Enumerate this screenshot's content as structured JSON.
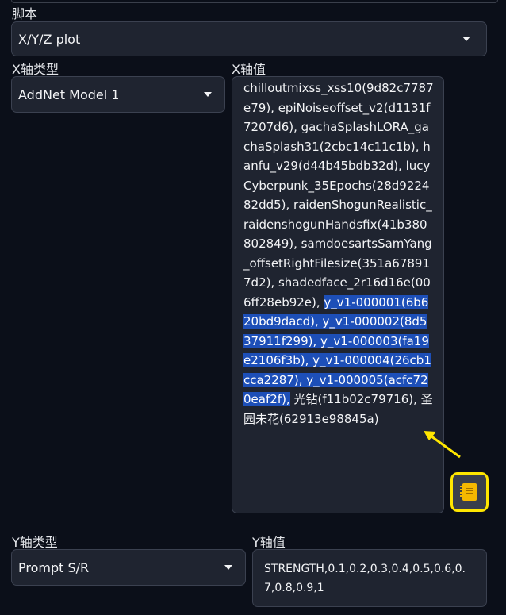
{
  "script": {
    "label": "脚本",
    "value": "X/Y/Z plot"
  },
  "x_axis": {
    "type_label": "X轴类型",
    "type_value": "AddNet Model 1",
    "values_label": "X轴值",
    "values_text_before": "chilloutmixss_xss10(9d82c7787e79), epiNoiseoffset_v2(d1131f7207d6), gachaSplashLORA_gachaSplash31(2cbc14c11c1b), hanfu_v29(d44b45bdb32d), lucyCyberpunk_35Epochs(28d922482dd5), raidenShogunRealistic_raidenshogunHandsfix(41b380802849), samdoesartsSamYang_offsetRightFilesize(351a678917d2), shadedface_2r16d16e(006ff28eb92e), ",
    "values_text_selected": "y_v1-000001(6b620bd9dacd), y_v1-000002(8d537911f299), y_v1-000003(fa19e2106f3b), y_v1-000004(26cb1cca2287), y_v1-000005(acfc720eaf2f),",
    "values_text_after": " 光钻(f11b02c79716), 圣园未花(62913e98845a)"
  },
  "y_axis": {
    "type_label": "Y轴类型",
    "type_value": "Prompt S/R",
    "values_label": "Y轴值",
    "values_text": "STRENGTH,0.1,0.2,0.3,0.4,0.5,0.6,0.7,0.8,0.9,1"
  },
  "icons": {
    "fill_button": "notebook-icon",
    "annotation": "arrow-annotation"
  },
  "colors": {
    "highlight": "#ffe600",
    "selection": "#1d4fb8"
  }
}
